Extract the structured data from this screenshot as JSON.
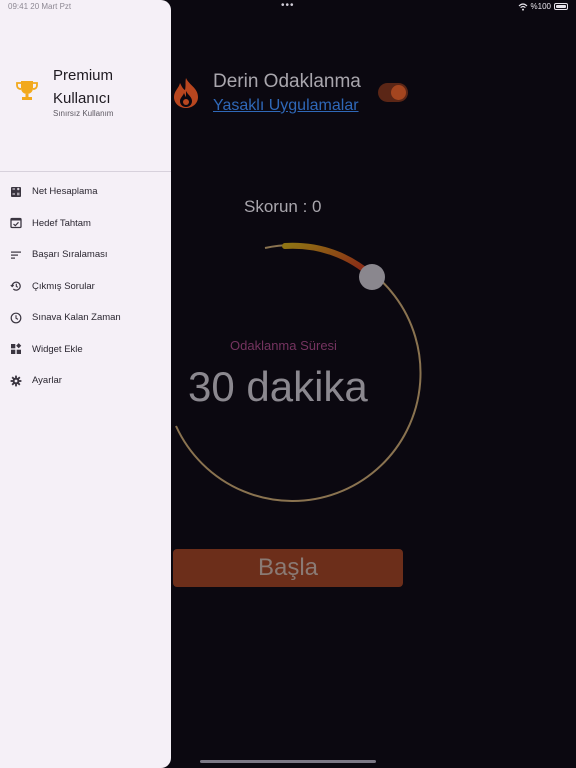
{
  "status": {
    "time": "09:41  20 Mart Pzt",
    "battery": "%100"
  },
  "drawer": {
    "title": "Premium Kullanıcı",
    "subtitle": "Sınırsız Kullanım",
    "items": [
      {
        "label": "Net Hesaplama",
        "icon": "calculator-icon"
      },
      {
        "label": "Hedef Tahtam",
        "icon": "check-board-icon"
      },
      {
        "label": "Başarı Sıralaması",
        "icon": "sort-icon"
      },
      {
        "label": "Çıkmış Sorular",
        "icon": "history-icon"
      },
      {
        "label": "Sınava Kalan Zaman",
        "icon": "clock-icon"
      },
      {
        "label": "Widget Ekle",
        "icon": "widgets-icon"
      },
      {
        "label": "Ayarlar",
        "icon": "gear-icon"
      }
    ]
  },
  "main": {
    "title": "Derin Odaklanma",
    "link": "Yasaklı Uygulamalar",
    "toggle_on": true,
    "score_label": "Skorun : 0",
    "dial_label": "Odaklanma Süresi",
    "dial_value": "30 dakika",
    "start_button": "Başla"
  },
  "colors": {
    "accent": "#a4451f",
    "link": "#2f68b8",
    "drawer_bg": "#f5f0f7",
    "background": "#0b0810",
    "dial_ring": "#8a7350"
  }
}
